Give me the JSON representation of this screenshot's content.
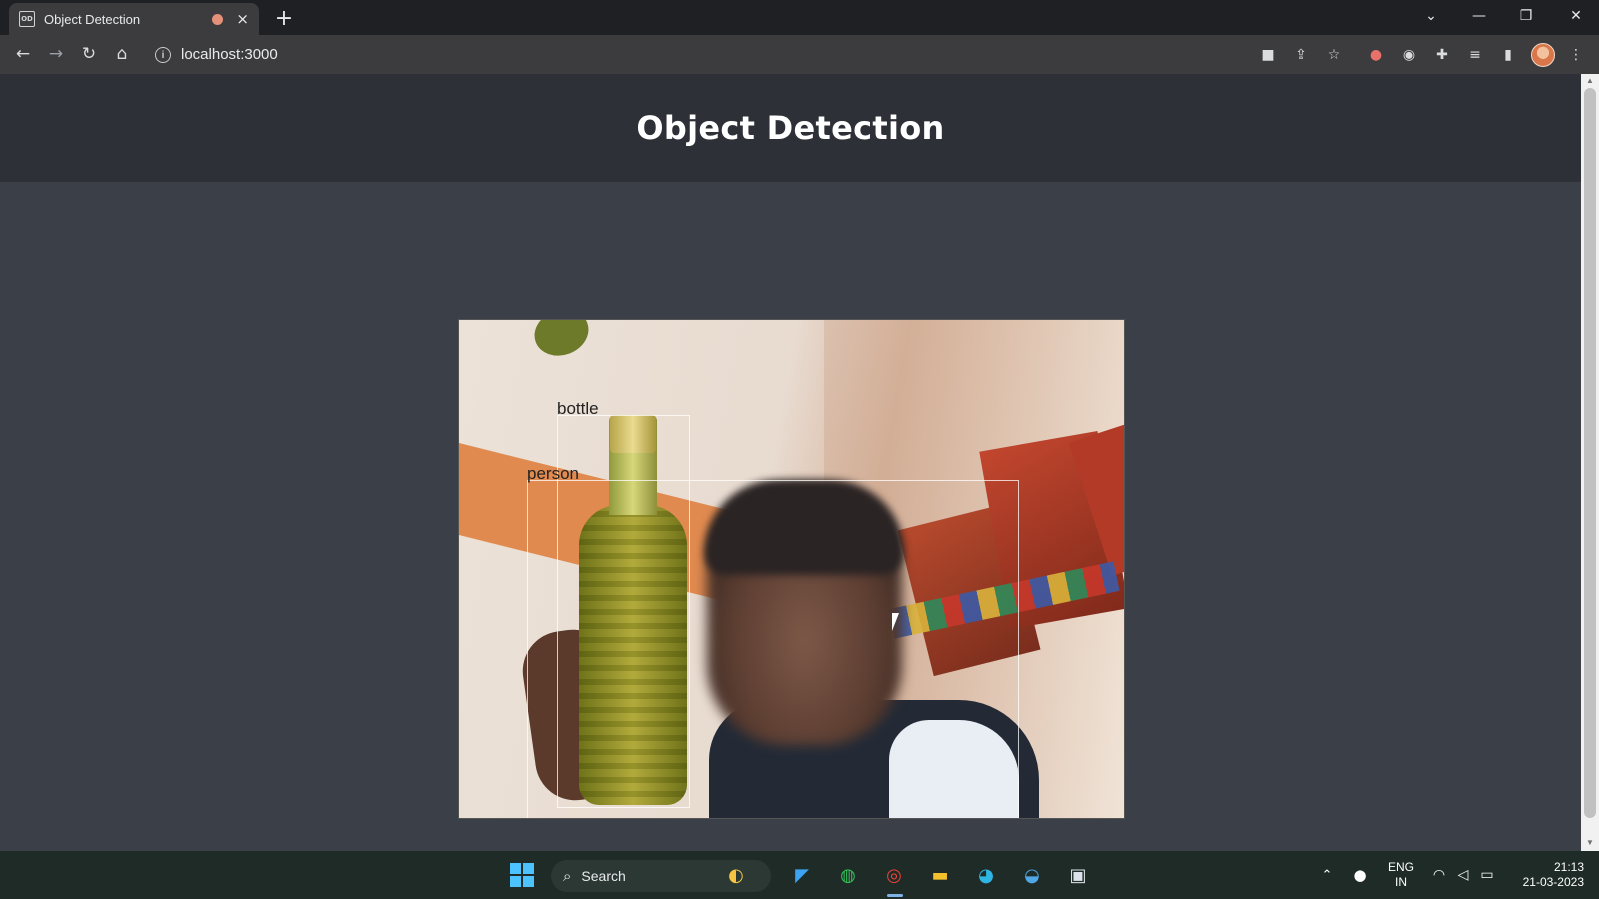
{
  "browser": {
    "tab_title": "Object Detection",
    "tab_favicon_text": "OD",
    "tab_close": "×",
    "new_tab": "+",
    "url": "localhost:3000",
    "window_controls": {
      "tabsearch": "⌄",
      "minimize": "—",
      "restore": "❐",
      "close": "✕"
    }
  },
  "page": {
    "heading": "Object Detection",
    "detections": [
      {
        "label": "bottle"
      },
      {
        "label": "person"
      }
    ]
  },
  "taskbar": {
    "search_label": "Search",
    "language": {
      "line1": "ENG",
      "line2": "IN"
    },
    "clock": {
      "time": "21:13",
      "date": "21-03-2023"
    }
  },
  "colors": {
    "page_background": "#3b4048",
    "header_background": "#2d3036",
    "browser_frame": "#1f2023",
    "taskbar": "#1f2b26",
    "windows_accent": "#4cc2ff"
  }
}
